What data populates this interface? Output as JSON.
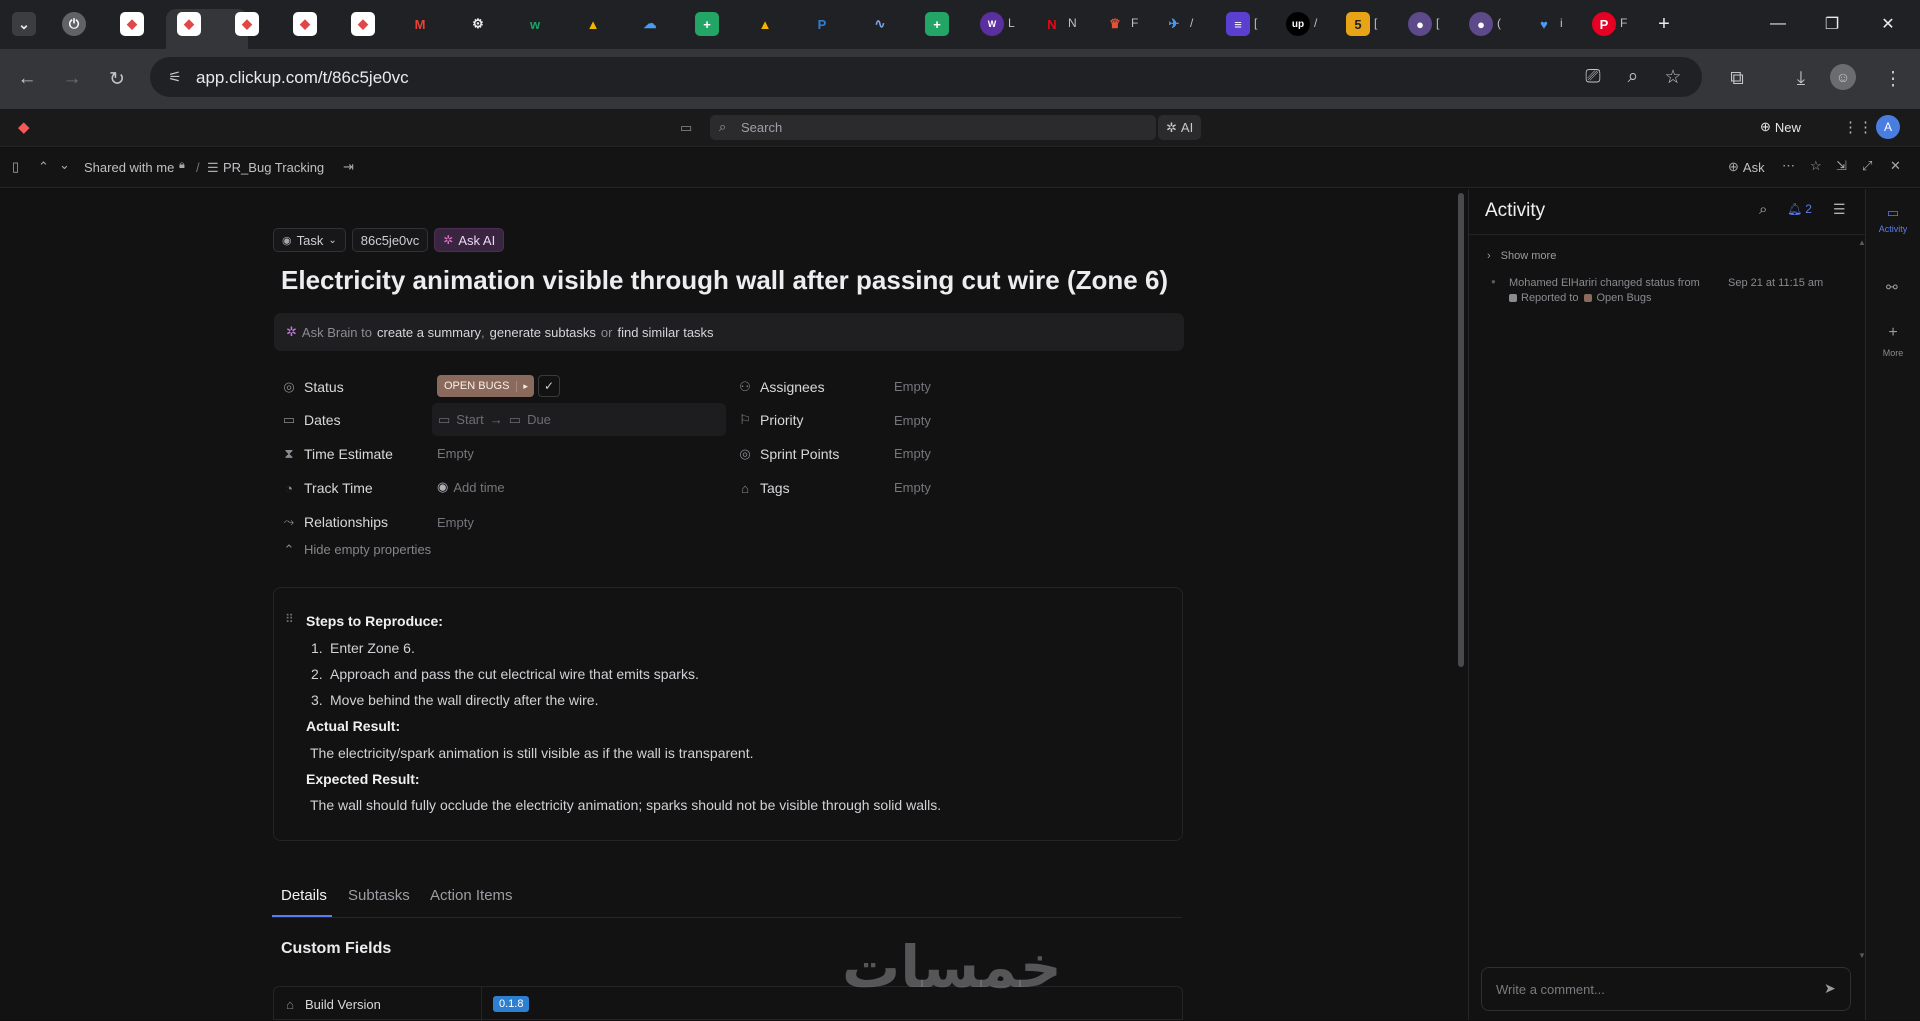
{
  "browser": {
    "url": "app.clickup.com/t/86c5je0vc",
    "tab_labels": [
      "L",
      "N",
      "F",
      "/",
      "[",
      "/",
      "[",
      "[",
      "(",
      "i",
      "F"
    ]
  },
  "app": {
    "search_placeholder": "Search",
    "ai_label": "AI",
    "new_label": "New",
    "avatar_letter": "A"
  },
  "breadcrumb": {
    "shared": "Shared with me",
    "separator": "/",
    "list": "PR_Bug Tracking",
    "ask_label": "Ask"
  },
  "task": {
    "type_label": "Task",
    "id": "86c5je0vc",
    "ask_ai_label": "Ask AI",
    "title": "Electricity animation visible through wall after passing cut wire (Zone 6)",
    "brain": {
      "prefix": "Ask Brain to",
      "summary": "create a summary",
      "comma": ",",
      "subtasks": "generate subtasks",
      "or": "or",
      "similar": "find similar tasks"
    }
  },
  "properties": {
    "status_label": "Status",
    "status_value": "OPEN BUGS",
    "dates_label": "Dates",
    "start_label": "Start",
    "due_label": "Due",
    "time_estimate_label": "Time Estimate",
    "time_estimate_value": "Empty",
    "track_time_label": "Track Time",
    "track_time_value": "Add time",
    "relationships_label": "Relationships",
    "relationships_value": "Empty",
    "assignees_label": "Assignees",
    "assignees_value": "Empty",
    "priority_label": "Priority",
    "priority_value": "Empty",
    "sprint_label": "Sprint Points",
    "sprint_value": "Empty",
    "tags_label": "Tags",
    "tags_value": "Empty",
    "hide_empty": "Hide empty properties"
  },
  "description": {
    "steps_heading": "Steps to Reproduce:",
    "steps": [
      {
        "num": "1.",
        "text": "Enter Zone 6."
      },
      {
        "num": "2.",
        "text": "Approach and pass the cut electrical wire that emits sparks."
      },
      {
        "num": "3.",
        "text": "Move behind the wall directly after the wire."
      }
    ],
    "actual_heading": "Actual Result:",
    "actual_text": "The electricity/spark animation is still visible as if the wall is transparent.",
    "expected_heading": "Expected Result:",
    "expected_text": "The wall should fully occlude the electricity animation; sparks should not be visible through solid walls."
  },
  "detail_tabs": [
    "Details",
    "Subtasks",
    "Action Items"
  ],
  "custom_fields": {
    "heading": "Custom Fields",
    "build_version_label": "Build Version",
    "build_version_value": "0.1.8"
  },
  "watermark": "خمسات",
  "activity": {
    "title": "Activity",
    "notif_count": "2",
    "show_more": "Show more",
    "entry_text": "Mohamed ElHariri changed status from",
    "entry_time": "Sep 21 at 11:15 am",
    "from_status": "Reported to",
    "to_status": "Open Bugs",
    "comment_placeholder": "Write a comment..."
  },
  "rail": {
    "activity_label": "Activity",
    "more_label": "More"
  },
  "colors": {
    "accent": "#5b7cf0",
    "status_bg": "#8a6a5c",
    "ask_ai_bg": "#3a2540",
    "build_badge": "#2f7fd1"
  }
}
